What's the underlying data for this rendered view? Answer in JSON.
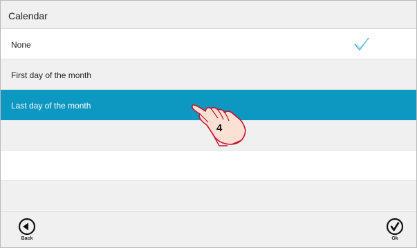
{
  "header": {
    "title": "Calendar"
  },
  "options": [
    {
      "label": "None",
      "checked": true
    },
    {
      "label": "First day of the month",
      "checked": false
    },
    {
      "label": "Last day of the month",
      "checked": false,
      "highlighted": true
    }
  ],
  "footer": {
    "back_label": "Back",
    "ok_label": "Ok"
  },
  "annotation": {
    "step": "4"
  },
  "colors": {
    "selected": "#0c98c0",
    "check": "#5ab7d6",
    "background_alt": "#f0f0f0"
  }
}
